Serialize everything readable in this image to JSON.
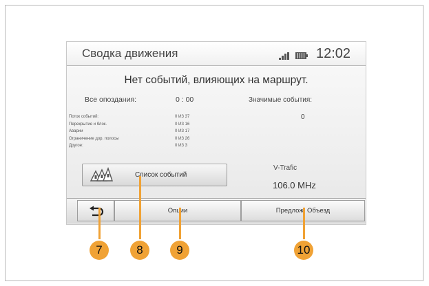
{
  "header": {
    "title": "Сводка движения",
    "time": "12:02"
  },
  "message": "Нет событий, влияющих на маршрут.",
  "delays": {
    "label": "Все опоздания:",
    "value": "0 : 00"
  },
  "significant": {
    "label": "Значимые события:",
    "value": "0"
  },
  "events": [
    {
      "label": "Поток событий:",
      "count": "0 ИЗ 37"
    },
    {
      "label": "Перекрытие и блок.",
      "count": "0 ИЗ 16"
    },
    {
      "label": "Аварии",
      "count": "0 ИЗ 17"
    },
    {
      "label": "Ограничение дор. полосы",
      "count": "0 ИЗ 26"
    },
    {
      "label": "Другое:",
      "count": "0 ИЗ 3"
    }
  ],
  "event_list_button": {
    "label": "Список событий"
  },
  "radio": {
    "service": "V-Trafic",
    "frequency": "106.0 MHz"
  },
  "bottom_bar": {
    "options_label": "Опции",
    "detour_label": "Предлож. Объезд"
  },
  "callouts": [
    "7",
    "8",
    "9",
    "10"
  ],
  "colors": {
    "callout": "#f0a235",
    "background": "#efefef"
  },
  "icons": {
    "back": "back-arrow-icon",
    "event_list": "road-signs-icon",
    "signal": "signal-strength-icon",
    "battery": "battery-icon"
  }
}
